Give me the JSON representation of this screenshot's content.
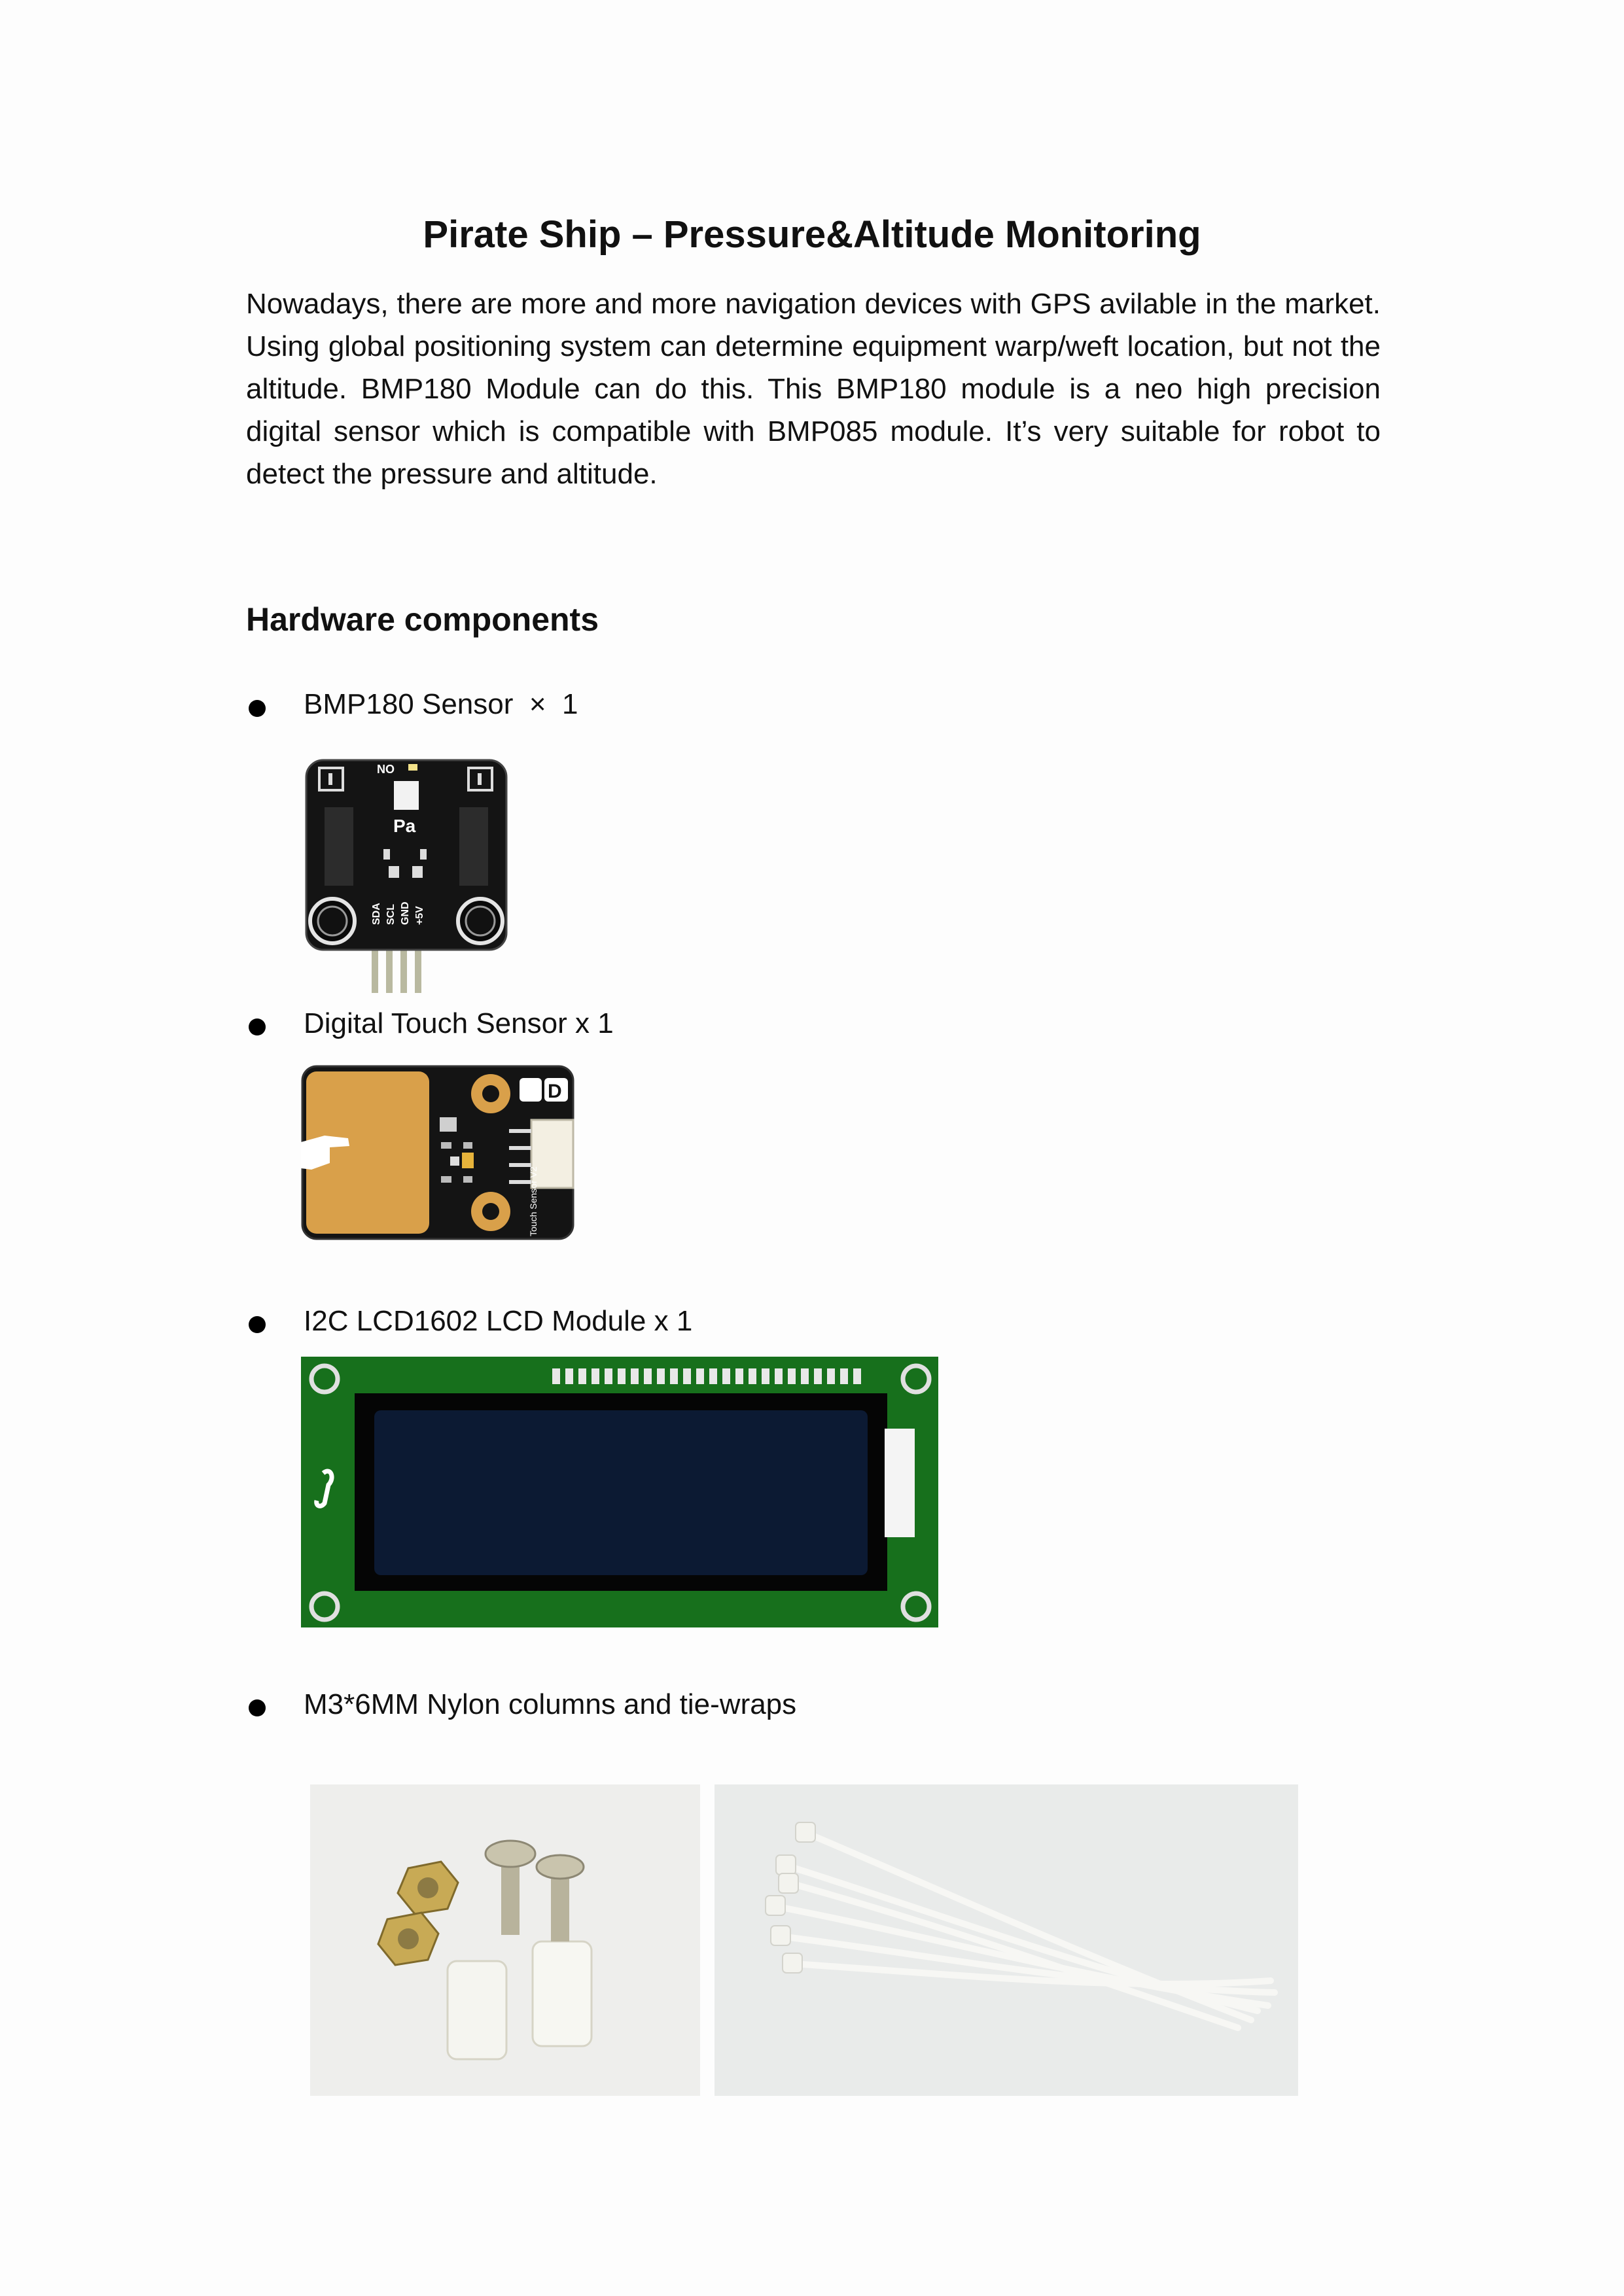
{
  "document": {
    "title": "Pirate Ship – Pressure&Altitude Monitoring",
    "intro": "Nowadays, there are more and more navigation devices with GPS avilable in the market. Using global positioning system can determine equipment warp/weft location, but not the altitude. BMP180 Module can do this. This BMP180 module is a neo high precision digital sensor which is compatible with BMP085 module. It’s very suitable for robot to detect the pressure and altitude.",
    "section_heading": "Hardware components",
    "components": [
      {
        "label": "BMP180 Sensor  ×  1"
      },
      {
        "label": "Digital Touch Sensor x 1"
      },
      {
        "label": "I2C LCD1602 LCD Module x 1"
      },
      {
        "label": "M3*6MM Nylon columns and tie-wraps"
      }
    ]
  },
  "bmp180_board": {
    "text_top": "NO",
    "text_center": "Pa",
    "pins": [
      "SDA",
      "SCL",
      "GND",
      "+5V"
    ]
  },
  "touch_board": {
    "text_side": "Touch Sensor V2",
    "text_logo": "D"
  },
  "colors": {
    "pcb_black": "#141414",
    "touch_pad": "#d9a04a",
    "lcd_green": "#17701c",
    "lcd_screen": "#0c1a33"
  }
}
